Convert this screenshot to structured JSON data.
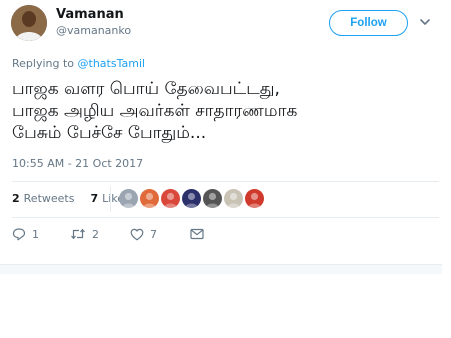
{
  "author": {
    "name": "Vamanan",
    "handle": "@vamananko"
  },
  "follow_label": "Follow",
  "reply_to": {
    "prefix": "Replying to",
    "mention": "@thatsTamil"
  },
  "tweet_lines": [
    "பாஜக வளர பொய் தேவைபட்டது,",
    "பாஜக அழிய அவர்கள் சாதாரணமாக",
    "பேசும் பேச்சே போதும்..."
  ],
  "timestamp": "10:55 AM - 21 Oct 2017",
  "stats": {
    "retweets_count": "2",
    "retweets_label": "Retweets",
    "likes_count": "7",
    "likes_label": "Likes"
  },
  "liker_colors": [
    "#9aa5b1",
    "#e06a3a",
    "#d9483b",
    "#2b2f6a",
    "#555555",
    "#c9c3b6",
    "#d03a2c"
  ],
  "actions": {
    "reply_count": "1",
    "retweet_count": "2",
    "like_count": "7"
  },
  "colors": {
    "accent": "#1da1f2",
    "secondary_text": "#657786"
  }
}
